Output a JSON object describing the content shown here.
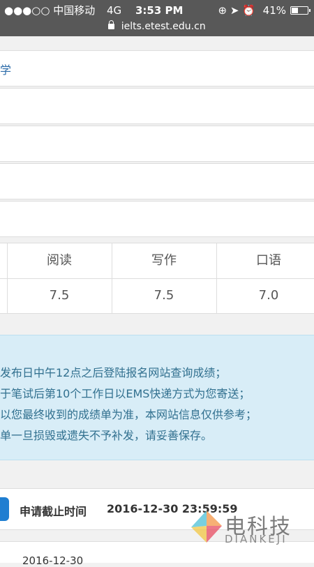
{
  "status_bar": {
    "carrier": "●●●○○ 中国移动",
    "network": "4G",
    "time": "3:53 PM",
    "icons": "⊕ ➤ ⏰",
    "battery": "41%",
    "battery_level": 0.41
  },
  "url_bar": {
    "domain": "ielts.etest.edu.cn"
  },
  "form": {
    "row1_text": "学"
  },
  "scores": {
    "headers": [
      "阅读",
      "写作",
      "口语"
    ],
    "values": [
      "7.5",
      "7.5",
      "7.0"
    ]
  },
  "notice": {
    "lines": [
      "发布日中午12点之后登陆报名网站查询成绩；",
      "于笔试后第10个工作日以EMS快递方式为您寄送；",
      "以您最终收到的成绩单为准，本网站信息仅供参考；",
      "单一旦损毁或遗失不予补发，请妥善保存。"
    ]
  },
  "deadline": {
    "label": "申请截止时间",
    "value": "2016-12-30 23:59:59"
  },
  "next_row": {
    "text": "2016-12-30"
  },
  "watermark": {
    "cn": "电科技",
    "en": "DIANKEJI"
  }
}
